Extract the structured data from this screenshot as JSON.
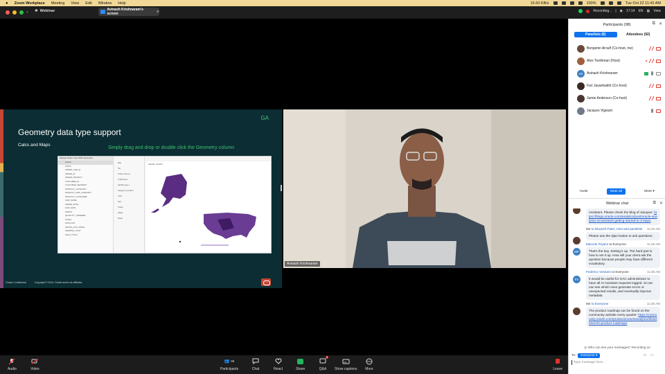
{
  "menubar": {
    "app": "Zoom Workplace",
    "items": [
      "Meeting",
      "View",
      "Edit",
      "Window",
      "Help"
    ],
    "battery": "100%",
    "date_time": "Tue Oct 22  11:42 AM",
    "network_rate": "15.60 KB/s"
  },
  "titlebar": {
    "webinar_label": "Webinar",
    "share_label": "Avinash Krishnaram's screen",
    "recording_label": "Recording...",
    "timer": "17:14",
    "lang": "EN",
    "view_label": "View"
  },
  "slide": {
    "badge": "GA",
    "title": "Geometry data type support",
    "subtitle": "Calcs and Maps",
    "hint": "Simply drag and drop or double click the Geometry column",
    "copyright": "Copyright © 2024, Oracle and/or its affiliates",
    "footer_left": "Oracle Confidential",
    "dataset_title": "Sample Order Lines SDO Geometry",
    "canvas_title": "GEOM, SALES",
    "fields": [
      "GEOM",
      "STATE",
      "ORDER_LINE_ID",
      "ORDER_ID",
      "ORDER_PRIORITY",
      "CUSTOMER_ID",
      "CUSTOMER_SEGMENT",
      "PRODUCT_CATEGORY",
      "PRODUCT_SUB_CATEGORY",
      "PRODUCT_CONTAINER",
      "SHIP_MODE",
      "ORDER_DATE",
      "SHIP_DATE",
      "PROFIT",
      "QUANTITY_ORDERED",
      "SALES",
      "DISCOUNT",
      "GROSS_UNIT_PRICE",
      "SHIPPING_COST",
      "SOLD_TOTAL"
    ],
    "grammar": [
      "Map",
      "Tile",
      "Trellis Columns",
      "Trellis Rows",
      "GEOM  Layer 1",
      "Category (Location)",
      "Color",
      "Size",
      "Tooltip",
      "Shape",
      "Detail"
    ]
  },
  "video": {
    "name": "Avinash Krishnaram"
  },
  "toolbar": {
    "audio": "Audio",
    "video": "Video",
    "participants": "Participants",
    "participants_count": "98",
    "chat": "Chat",
    "react": "React",
    "share": "Share",
    "qa": "Q&A",
    "qa_badge": "3",
    "captions": "Show captions",
    "more": "More",
    "leave": "Leave"
  },
  "participants": {
    "header": "Participants (98)",
    "tab_panelists": "Panelists (6)",
    "tab_attendees": "Attendees (92)",
    "list": [
      {
        "name": "Benjamin Arnulf (Co-host, me)",
        "initials": ""
      },
      {
        "name": "Alex Toothman (Host)",
        "initials": ""
      },
      {
        "name": "Avinash Krishnaram",
        "initials": "AK"
      },
      {
        "name": "Fari Javanbakht (Co-host)",
        "initials": ""
      },
      {
        "name": "Jamie Anderson (Co-host)",
        "initials": ""
      },
      {
        "name": "Jacques Vigeant",
        "initials": ""
      }
    ],
    "invite": "Invite",
    "mute_all": "Mute all",
    "more": "More"
  },
  "chat": {
    "header": "Webinar chat",
    "messages": [
      {
        "from": "",
        "to": "",
        "time": "",
        "initials": "",
        "text": "Assistant. Please check the blog of Jacques: ",
        "link": "https://blogs.oracle.com/analytics/post/oracle-analytics-ai-assistant-getting-started-in-3-steps"
      },
      {
        "from": "Me",
        "to": "to Divyesh Patel, Host and panelists",
        "time": "11:25 AM",
        "initials": "",
        "text": "Please use the Q&A button to ask questions.",
        "link": ""
      },
      {
        "from": "Marcelo Pryano",
        "to": "to Everyone",
        "time": "11:28 AM",
        "initials": "MP",
        "text": "That's the key. Setting it up. The hard part is how to set it up. How will your client ask the question because people may have different vocabulary.",
        "link": ""
      },
      {
        "from": "Federico Venturin",
        "to": "to Everyone",
        "time": "11:35 AM",
        "initials": "FV",
        "text": "It would be useful for OAC administrator to have all AI Assistant requests logged. So we can see which ones generate errors or unexpected results, and eventually improve metadata",
        "link": ""
      },
      {
        "from": "Me",
        "to": "to Everyone",
        "time": "11:36 AM",
        "initials": "",
        "text": "The product roadmap can be found on the community website every quarter: ",
        "link": "https://community.oracle.com/products/oracleanalytics/kb/articles/32-product-roadmaps"
      }
    ],
    "visibility_hint": "Who can see your messages? Recording on",
    "to_label": "To:",
    "to_value": "Everyone",
    "placeholder": "Type message here..."
  },
  "colors": {
    "slide_bg": "#0b2d33",
    "oracle_red": "#c74634",
    "accent_green": "#3fc470",
    "zoom_blue": "#0e72ed",
    "menubar_bg": "#f1d896"
  }
}
